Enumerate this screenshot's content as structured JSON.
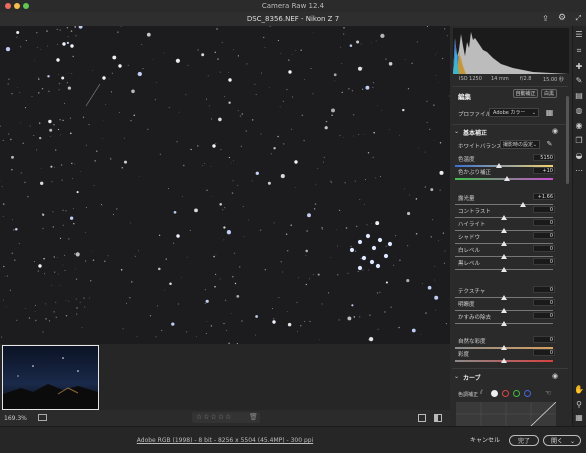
{
  "app": {
    "title": "Camera Raw 12.4"
  },
  "file": {
    "title": "DSC_8356.NEF  -  Nikon Z 7"
  },
  "histogram": {
    "iso": "ISO 1250",
    "focal": "14 mm",
    "aperture": "f/2.8",
    "shutter": "15.00 秒"
  },
  "edit": {
    "title": "編集",
    "auto_label": "自動補正",
    "bw_label": "白黒",
    "profile_label": "プロファイル",
    "profile_value": "Adobe カラー"
  },
  "basic": {
    "title": "基本補正",
    "wb_label": "ホワイトバランス",
    "wb_value": "撮影時の設定",
    "sliders": [
      {
        "label": "色温度",
        "value": "5150",
        "pos": 0.45
      },
      {
        "label": "色かぶり補正",
        "value": "+10",
        "pos": 0.53
      },
      {
        "label": "露光量",
        "value": "+1.66",
        "pos": 0.69
      },
      {
        "label": "コントラスト",
        "value": "0",
        "pos": 0.5
      },
      {
        "label": "ハイライト",
        "value": "0",
        "pos": 0.5
      },
      {
        "label": "シャドウ",
        "value": "0",
        "pos": 0.5
      },
      {
        "label": "白レベル",
        "value": "0",
        "pos": 0.5
      },
      {
        "label": "黒レベル",
        "value": "0",
        "pos": 0.5
      },
      {
        "label": "テクスチャ",
        "value": "0",
        "pos": 0.5
      },
      {
        "label": "明瞭度",
        "value": "0",
        "pos": 0.5
      },
      {
        "label": "かすみの除去",
        "value": "0",
        "pos": 0.5
      },
      {
        "label": "自然な彩度",
        "value": "0",
        "pos": 0.5
      },
      {
        "label": "彩度",
        "value": "0",
        "pos": 0.5
      }
    ]
  },
  "curve": {
    "title": "カーブ",
    "adjust_label": "色調補正"
  },
  "toolbar": {
    "zoom": "169.3%",
    "rating_stars": "☆☆☆☆☆"
  },
  "footer": {
    "info_link": "Adobe RGB (1998) - 8 bit - 8256 x 5504 (45.4MP) - 300 ppi",
    "cancel_label": "キャンセル",
    "done_label": "完了",
    "open_label": "開く"
  },
  "colors": {
    "accent": "#3d6fd8",
    "panel": "#2a2a2a",
    "canvas": "#1b1b1b"
  }
}
